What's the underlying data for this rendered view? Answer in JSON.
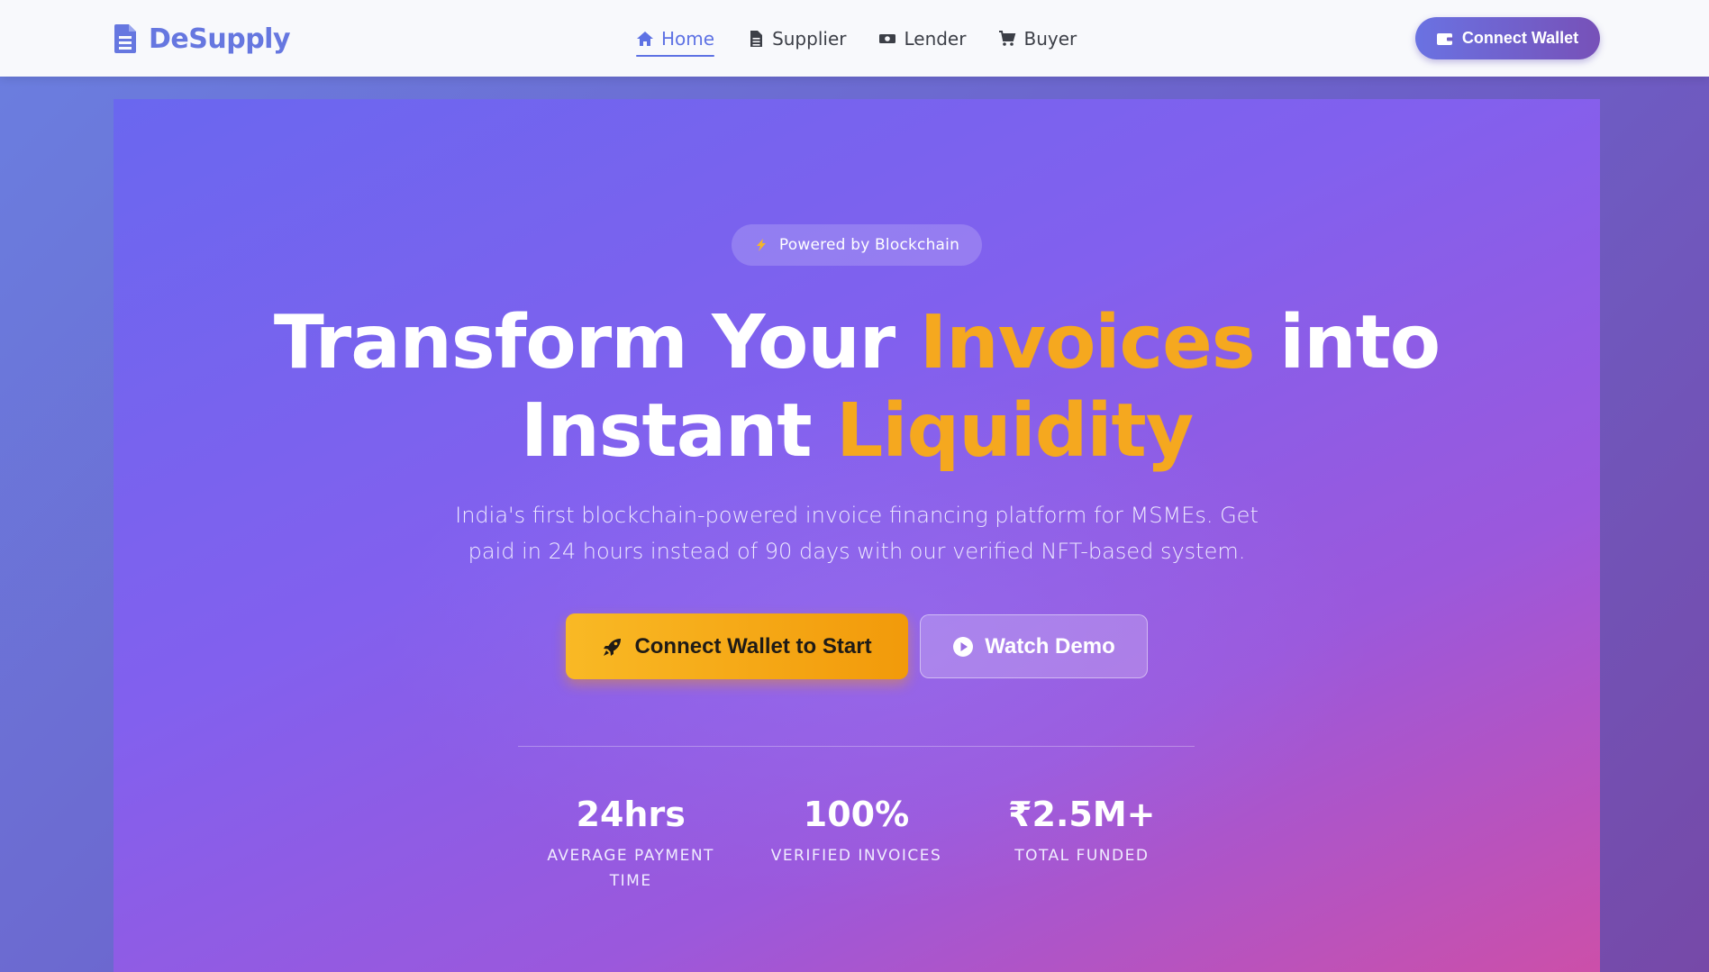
{
  "brand": {
    "name": "DeSupply",
    "accent": "#6677e0"
  },
  "nav": {
    "items": [
      {
        "label": "Home",
        "icon": "home-icon",
        "active": true
      },
      {
        "label": "Supplier",
        "icon": "document-icon",
        "active": false
      },
      {
        "label": "Lender",
        "icon": "money-icon",
        "active": false
      },
      {
        "label": "Buyer",
        "icon": "cart-icon",
        "active": false
      }
    ]
  },
  "header": {
    "connect_label": "Connect Wallet",
    "connect_icon": "wallet-icon"
  },
  "hero": {
    "badge": {
      "label": "Powered by Blockchain",
      "icon": "lightning-icon"
    },
    "headline": {
      "line1_a": "Transform Your ",
      "line1_b": "Invoices",
      "line1_c": " into",
      "line2_a": "Instant ",
      "line2_b": "Liquidity"
    },
    "subtitle": "India's first blockchain-powered invoice financing platform for MSMEs. Get paid in 24 hours instead of 90 days with our verified NFT-based system.",
    "primary_cta": {
      "label": "Connect Wallet to Start",
      "icon": "rocket-icon"
    },
    "secondary_cta": {
      "label": "Watch Demo",
      "icon": "play-circle-icon"
    },
    "highlight_color": "#f5a81f"
  },
  "stats": [
    {
      "value": "24hrs",
      "label": "Average Payment Time"
    },
    {
      "value": "100%",
      "label": "Verified Invoices"
    },
    {
      "value": "₹2.5M+",
      "label": "Total Funded"
    }
  ]
}
